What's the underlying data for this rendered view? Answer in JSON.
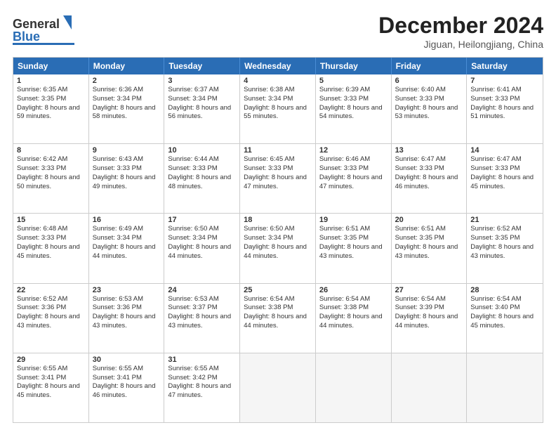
{
  "header": {
    "logo_general": "General",
    "logo_blue": "Blue",
    "title": "December 2024",
    "location": "Jiguan, Heilongjiang, China"
  },
  "days_of_week": [
    "Sunday",
    "Monday",
    "Tuesday",
    "Wednesday",
    "Thursday",
    "Friday",
    "Saturday"
  ],
  "weeks": [
    [
      {
        "day": "1",
        "sunrise": "Sunrise: 6:35 AM",
        "sunset": "Sunset: 3:35 PM",
        "daylight": "Daylight: 8 hours and 59 minutes."
      },
      {
        "day": "2",
        "sunrise": "Sunrise: 6:36 AM",
        "sunset": "Sunset: 3:34 PM",
        "daylight": "Daylight: 8 hours and 58 minutes."
      },
      {
        "day": "3",
        "sunrise": "Sunrise: 6:37 AM",
        "sunset": "Sunset: 3:34 PM",
        "daylight": "Daylight: 8 hours and 56 minutes."
      },
      {
        "day": "4",
        "sunrise": "Sunrise: 6:38 AM",
        "sunset": "Sunset: 3:34 PM",
        "daylight": "Daylight: 8 hours and 55 minutes."
      },
      {
        "day": "5",
        "sunrise": "Sunrise: 6:39 AM",
        "sunset": "Sunset: 3:33 PM",
        "daylight": "Daylight: 8 hours and 54 minutes."
      },
      {
        "day": "6",
        "sunrise": "Sunrise: 6:40 AM",
        "sunset": "Sunset: 3:33 PM",
        "daylight": "Daylight: 8 hours and 53 minutes."
      },
      {
        "day": "7",
        "sunrise": "Sunrise: 6:41 AM",
        "sunset": "Sunset: 3:33 PM",
        "daylight": "Daylight: 8 hours and 51 minutes."
      }
    ],
    [
      {
        "day": "8",
        "sunrise": "Sunrise: 6:42 AM",
        "sunset": "Sunset: 3:33 PM",
        "daylight": "Daylight: 8 hours and 50 minutes."
      },
      {
        "day": "9",
        "sunrise": "Sunrise: 6:43 AM",
        "sunset": "Sunset: 3:33 PM",
        "daylight": "Daylight: 8 hours and 49 minutes."
      },
      {
        "day": "10",
        "sunrise": "Sunrise: 6:44 AM",
        "sunset": "Sunset: 3:33 PM",
        "daylight": "Daylight: 8 hours and 48 minutes."
      },
      {
        "day": "11",
        "sunrise": "Sunrise: 6:45 AM",
        "sunset": "Sunset: 3:33 PM",
        "daylight": "Daylight: 8 hours and 47 minutes."
      },
      {
        "day": "12",
        "sunrise": "Sunrise: 6:46 AM",
        "sunset": "Sunset: 3:33 PM",
        "daylight": "Daylight: 8 hours and 47 minutes."
      },
      {
        "day": "13",
        "sunrise": "Sunrise: 6:47 AM",
        "sunset": "Sunset: 3:33 PM",
        "daylight": "Daylight: 8 hours and 46 minutes."
      },
      {
        "day": "14",
        "sunrise": "Sunrise: 6:47 AM",
        "sunset": "Sunset: 3:33 PM",
        "daylight": "Daylight: 8 hours and 45 minutes."
      }
    ],
    [
      {
        "day": "15",
        "sunrise": "Sunrise: 6:48 AM",
        "sunset": "Sunset: 3:33 PM",
        "daylight": "Daylight: 8 hours and 45 minutes."
      },
      {
        "day": "16",
        "sunrise": "Sunrise: 6:49 AM",
        "sunset": "Sunset: 3:34 PM",
        "daylight": "Daylight: 8 hours and 44 minutes."
      },
      {
        "day": "17",
        "sunrise": "Sunrise: 6:50 AM",
        "sunset": "Sunset: 3:34 PM",
        "daylight": "Daylight: 8 hours and 44 minutes."
      },
      {
        "day": "18",
        "sunrise": "Sunrise: 6:50 AM",
        "sunset": "Sunset: 3:34 PM",
        "daylight": "Daylight: 8 hours and 44 minutes."
      },
      {
        "day": "19",
        "sunrise": "Sunrise: 6:51 AM",
        "sunset": "Sunset: 3:35 PM",
        "daylight": "Daylight: 8 hours and 43 minutes."
      },
      {
        "day": "20",
        "sunrise": "Sunrise: 6:51 AM",
        "sunset": "Sunset: 3:35 PM",
        "daylight": "Daylight: 8 hours and 43 minutes."
      },
      {
        "day": "21",
        "sunrise": "Sunrise: 6:52 AM",
        "sunset": "Sunset: 3:35 PM",
        "daylight": "Daylight: 8 hours and 43 minutes."
      }
    ],
    [
      {
        "day": "22",
        "sunrise": "Sunrise: 6:52 AM",
        "sunset": "Sunset: 3:36 PM",
        "daylight": "Daylight: 8 hours and 43 minutes."
      },
      {
        "day": "23",
        "sunrise": "Sunrise: 6:53 AM",
        "sunset": "Sunset: 3:36 PM",
        "daylight": "Daylight: 8 hours and 43 minutes."
      },
      {
        "day": "24",
        "sunrise": "Sunrise: 6:53 AM",
        "sunset": "Sunset: 3:37 PM",
        "daylight": "Daylight: 8 hours and 43 minutes."
      },
      {
        "day": "25",
        "sunrise": "Sunrise: 6:54 AM",
        "sunset": "Sunset: 3:38 PM",
        "daylight": "Daylight: 8 hours and 44 minutes."
      },
      {
        "day": "26",
        "sunrise": "Sunrise: 6:54 AM",
        "sunset": "Sunset: 3:38 PM",
        "daylight": "Daylight: 8 hours and 44 minutes."
      },
      {
        "day": "27",
        "sunrise": "Sunrise: 6:54 AM",
        "sunset": "Sunset: 3:39 PM",
        "daylight": "Daylight: 8 hours and 44 minutes."
      },
      {
        "day": "28",
        "sunrise": "Sunrise: 6:54 AM",
        "sunset": "Sunset: 3:40 PM",
        "daylight": "Daylight: 8 hours and 45 minutes."
      }
    ],
    [
      {
        "day": "29",
        "sunrise": "Sunrise: 6:55 AM",
        "sunset": "Sunset: 3:41 PM",
        "daylight": "Daylight: 8 hours and 45 minutes."
      },
      {
        "day": "30",
        "sunrise": "Sunrise: 6:55 AM",
        "sunset": "Sunset: 3:41 PM",
        "daylight": "Daylight: 8 hours and 46 minutes."
      },
      {
        "day": "31",
        "sunrise": "Sunrise: 6:55 AM",
        "sunset": "Sunset: 3:42 PM",
        "daylight": "Daylight: 8 hours and 47 minutes."
      },
      {
        "day": "",
        "sunrise": "",
        "sunset": "",
        "daylight": ""
      },
      {
        "day": "",
        "sunrise": "",
        "sunset": "",
        "daylight": ""
      },
      {
        "day": "",
        "sunrise": "",
        "sunset": "",
        "daylight": ""
      },
      {
        "day": "",
        "sunrise": "",
        "sunset": "",
        "daylight": ""
      }
    ]
  ]
}
